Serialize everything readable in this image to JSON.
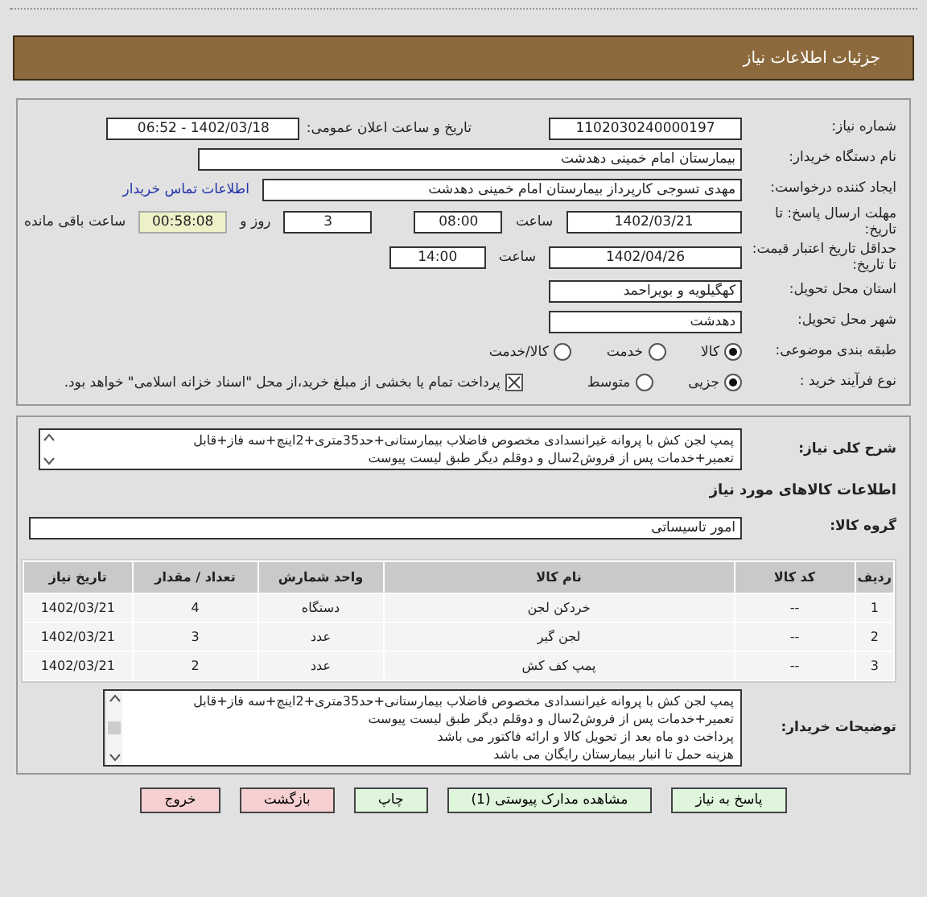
{
  "header": {
    "title": "جزئیات اطلاعات نیاز"
  },
  "need_number": {
    "label": "شماره نیاز:",
    "value": "1102030240000197"
  },
  "announce": {
    "label": "تاریخ و ساعت اعلان عمومی:",
    "value": "1402/03/18 - 06:52"
  },
  "buyer_org": {
    "label": "نام دستگاه خریدار:",
    "value": "بیمارستان امام خمینی دهدشت"
  },
  "requester": {
    "label": "ایجاد کننده درخواست:",
    "value": "مهدی تسوجی کارپرداز بیمارستان امام خمینی دهدشت",
    "link": "اطلاعات تماس خریدار"
  },
  "deadline": {
    "label": "مهلت ارسال پاسخ: تا تاریخ:",
    "date": "1402/03/21",
    "time_label": "ساعت",
    "time": "08:00",
    "days": "3",
    "days_label": "روز و",
    "remaining": "00:58:08",
    "remaining_label": "ساعت باقی مانده"
  },
  "validity": {
    "label": "حداقل تاریخ اعتبار قیمت: تا تاریخ:",
    "date": "1402/04/26",
    "time_label": "ساعت",
    "time": "14:00"
  },
  "province": {
    "label": "استان محل تحویل:",
    "value": "کهگیلویه و بویراحمد"
  },
  "city": {
    "label": "شهر محل تحویل:",
    "value": "دهدشت"
  },
  "category": {
    "label": "طبقه بندی موضوعی:",
    "options": [
      {
        "label": "کالا",
        "selected": true
      },
      {
        "label": "خدمت",
        "selected": false
      },
      {
        "label": "کالا/خدمت",
        "selected": false
      }
    ]
  },
  "process": {
    "label": "نوع فرآیند خرید :",
    "options": [
      {
        "label": "جزیی",
        "selected": true
      },
      {
        "label": "متوسط",
        "selected": false
      }
    ],
    "treasury": {
      "checked": true,
      "label": "پرداخت تمام یا بخشی از مبلغ خرید،از محل \"اسناد خزانه اسلامی\" خواهد بود."
    }
  },
  "summary": {
    "label": "شرح کلی نیاز:",
    "lines": [
      "پمپ لجن کش با پروانه غیرانسدادی مخصوص فاضلاب بیمارستانی+حد35متری+2اینچ+سه فاز+قابل",
      "تعمیر+خدمات پس از فروش2سال و دوقلم دیگر طبق لیست پیوست"
    ]
  },
  "goods_heading": "اطلاعات کالاهای مورد نیاز",
  "goods_group": {
    "label": "گروه کالا:",
    "value": "امور تاسیساتی"
  },
  "table": {
    "columns": [
      "ردیف",
      "کد کالا",
      "نام کالا",
      "واحد شمارش",
      "تعداد / مقدار",
      "تاریخ نیاز"
    ],
    "rows": [
      [
        "1",
        "--",
        "خردکن لجن",
        "دستگاه",
        "4",
        "1402/03/21"
      ],
      [
        "2",
        "--",
        "لجن گیر",
        "عدد",
        "3",
        "1402/03/21"
      ],
      [
        "3",
        "--",
        "پمپ کف کش",
        "عدد",
        "2",
        "1402/03/21"
      ]
    ]
  },
  "notes": {
    "label": "توضیحات خریدار:",
    "lines": [
      "پمپ لجن کش با پروانه غیرانسدادی مخصوص فاضلاب بیمارستانی+حد35متری+2اینچ+سه فاز+قابل",
      "تعمیر+خدمات پس از فروش2سال و دوقلم دیگر طبق لیست پیوست",
      "پرداخت دو ماه بعد از تحویل کالا و ارائه فاکتور می باشد",
      "هزینه حمل تا انبار بیمارستان رایگان می باشد"
    ]
  },
  "buttons": [
    {
      "label": "پاسخ به نیاز",
      "kind": "green"
    },
    {
      "label": "مشاهده مدارک پیوستی (1)",
      "kind": "green"
    },
    {
      "label": "چاپ",
      "kind": "green"
    },
    {
      "label": "بازگشت",
      "kind": "red"
    },
    {
      "label": "خروج",
      "kind": "red"
    }
  ]
}
